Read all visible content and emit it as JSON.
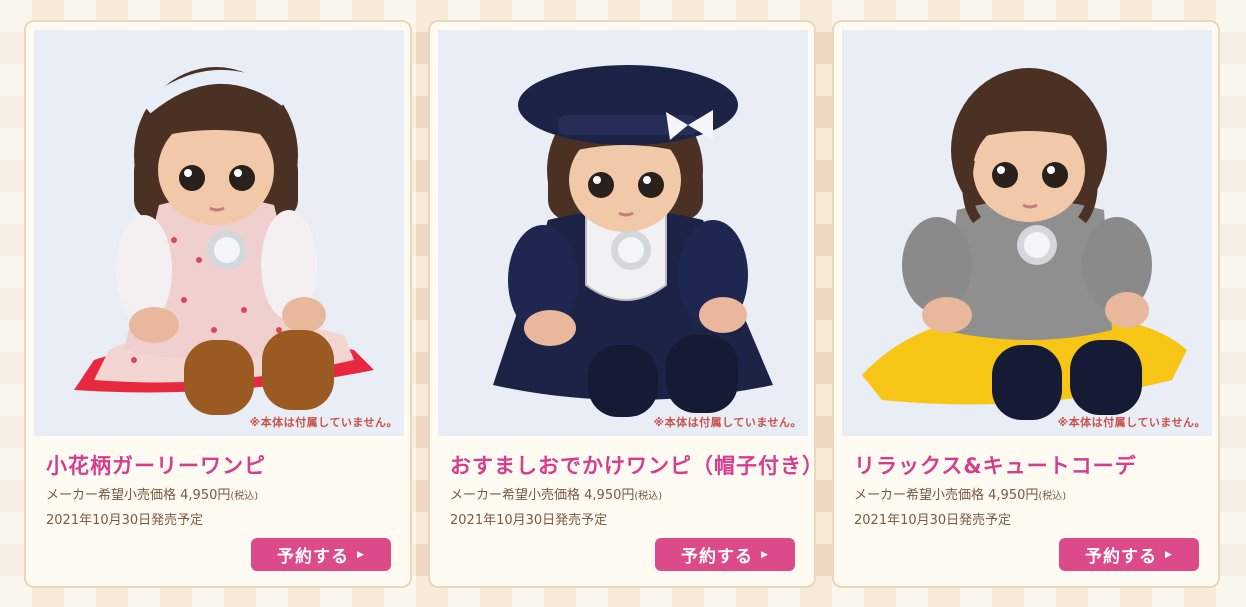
{
  "products": [
    {
      "name": "小花柄ガーリーワンピ",
      "price_label": "メーカー希望小売価格",
      "price": "4,950円",
      "tax_label": "(税込)",
      "release": "2021年10月30日発売予定",
      "note": "※本体は付属していません。",
      "button_label": "予約する",
      "button_icon": "play-arrow-icon"
    },
    {
      "name": "おすましおでかけワンピ（帽子付き）",
      "price_label": "メーカー希望小売価格",
      "price": "4,950円",
      "tax_label": "(税込)",
      "release": "2021年10月30日発売予定",
      "note": "※本体は付属していません。",
      "button_label": "予約する",
      "button_icon": "play-arrow-icon"
    },
    {
      "name": "リラックス&キュートコーデ",
      "price_label": "メーカー希望小売価格",
      "price": "4,950円",
      "tax_label": "(税込)",
      "release": "2021年10月30日発売予定",
      "note": "※本体は付属していません。",
      "button_label": "予約する",
      "button_icon": "play-arrow-icon"
    }
  ],
  "colors": {
    "accent": "#dc4a8a",
    "title": "#d63e8d",
    "text": "#7a5a3f",
    "note": "#c9524b",
    "card_bg": "#fffbf3",
    "card_border": "#ecd6b6"
  }
}
